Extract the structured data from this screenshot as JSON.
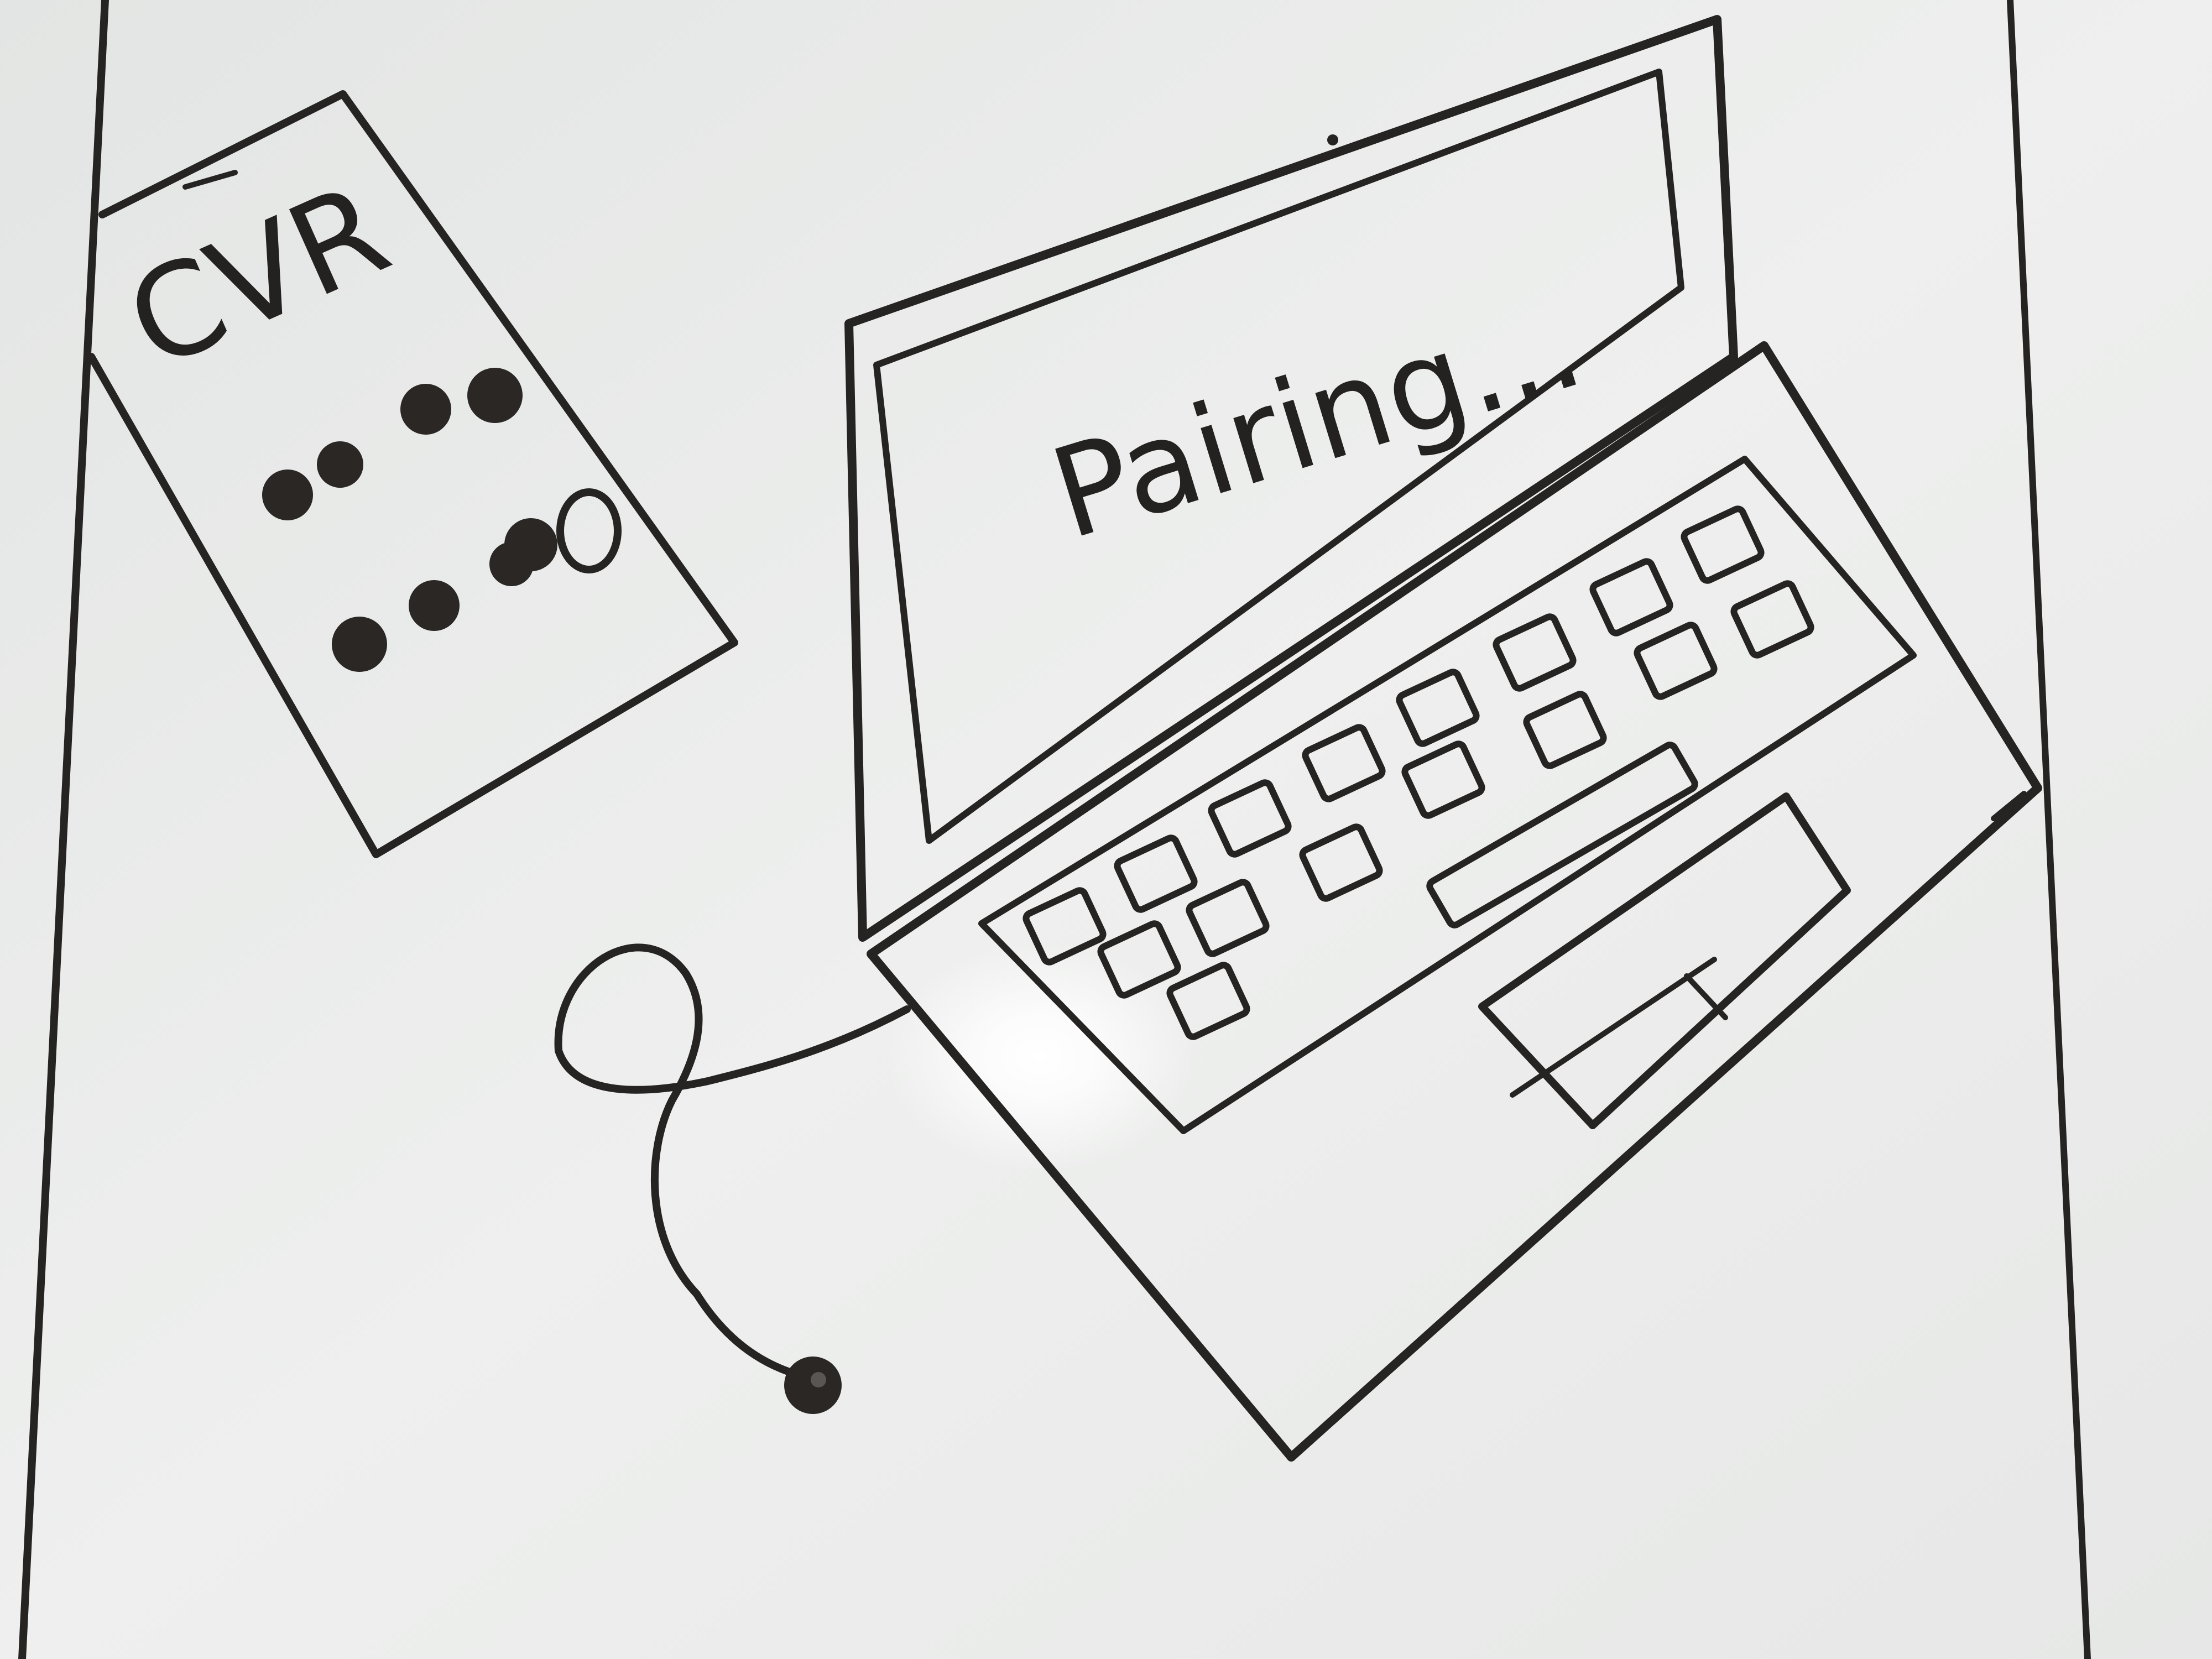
{
  "cvr_device": {
    "label": "CVR"
  },
  "laptop": {
    "screen_text": "Pairing..."
  },
  "colors": {
    "whiteboard": "#ecedec",
    "marker_ink": "#262422",
    "board_frame": "#c9cbca"
  }
}
